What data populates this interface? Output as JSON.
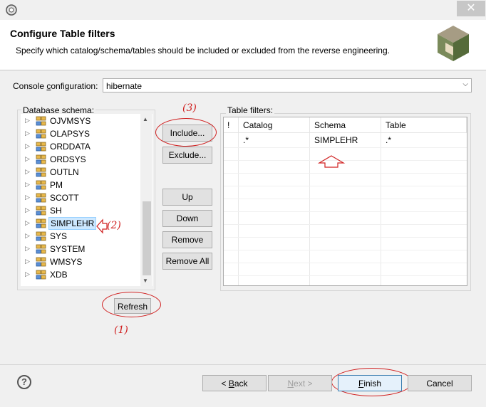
{
  "window": {
    "close_glyph": "✕"
  },
  "header": {
    "title": "Configure Table filters",
    "description": "Specify which catalog/schema/tables should be included or excluded from the reverse engineering."
  },
  "console": {
    "label_pre": "Console ",
    "label_u": "c",
    "label_post": "onfiguration:",
    "value": "hibernate"
  },
  "schema": {
    "legend": "Database schema:",
    "items": [
      "OJVMSYS",
      "OLAPSYS",
      "ORDDATA",
      "ORDSYS",
      "OUTLN",
      "PM",
      "SCOTT",
      "SH",
      "SIMPLEHR",
      "SYS",
      "SYSTEM",
      "WMSYS",
      "XDB"
    ],
    "selected": "SIMPLEHR"
  },
  "buttons": {
    "include": "Include...",
    "exclude": "Exclude...",
    "up": "Up",
    "down": "Down",
    "remove": "Remove",
    "remove_all": "Remove All",
    "refresh": "Refresh"
  },
  "filters": {
    "legend": "Table filters:",
    "columns": [
      "!",
      "Catalog",
      "Schema",
      "Table"
    ],
    "rows": [
      {
        "flag": "",
        "catalog": ".*",
        "schema": "SIMPLEHR",
        "table": ".*"
      }
    ]
  },
  "annotations": {
    "one": "(1)",
    "two": "(2)",
    "three": "(3)"
  },
  "footer": {
    "help": "?",
    "back_u": "B",
    "back_post": "ack",
    "back_pre": "< ",
    "next_u": "N",
    "next_post": "ext >",
    "finish_u": "F",
    "finish_post": "inish",
    "cancel": "Cancel"
  }
}
